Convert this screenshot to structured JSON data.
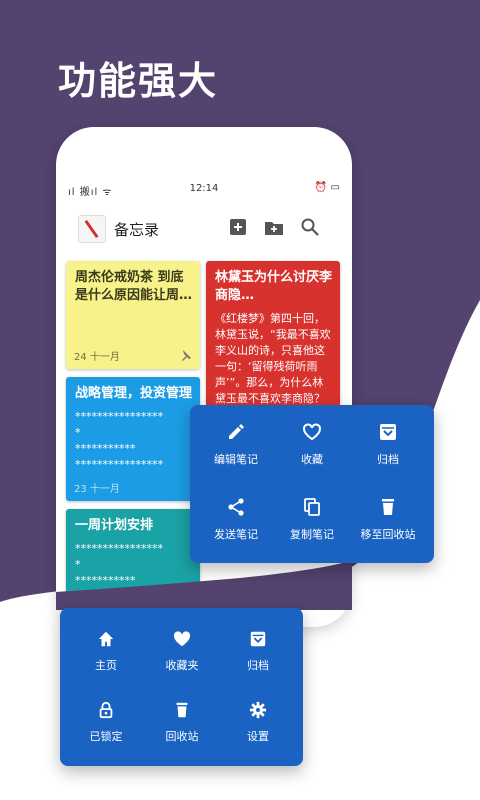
{
  "headline": "功能强大",
  "status": {
    "left": "ıl 搬ıl ᯤ",
    "time": "12:14",
    "right": "⏰ ▭"
  },
  "app": {
    "title": "备忘录"
  },
  "notes": [
    {
      "title": "周杰伦戒奶茶  到底是什么原因能让周…",
      "body": "",
      "date": "24  十一月",
      "color": "#f7f28a"
    },
    {
      "title": "林黛玉为什么讨厌李商隐…",
      "body": "《红楼梦》第四十回，林黛玉说，“我最不喜欢李义山的诗，只喜他这一句：‘留得残荷听雨声’”。那么，为什么林黛玉最不喜欢李商隐？以下是关于李商隐、关…",
      "date": "",
      "color": "#d8322f"
    },
    {
      "title": "战略管理，投资管理",
      "body": "****************\n*\n***********\n****************",
      "date": "23  十一月",
      "color": "#1d9ce6"
    },
    {
      "title": "一周计划安排",
      "body": "****************\n*\n***********",
      "date": "",
      "color": "#1aa3a6"
    }
  ],
  "note_menu": {
    "items": [
      {
        "label": "编辑笔记",
        "icon": "pencil-icon"
      },
      {
        "label": "收藏",
        "icon": "heart-outline-icon"
      },
      {
        "label": "归档",
        "icon": "archive-icon"
      },
      {
        "label": "发送笔记",
        "icon": "share-icon"
      },
      {
        "label": "复制笔记",
        "icon": "copy-icon"
      },
      {
        "label": "移至回收站",
        "icon": "trash-icon"
      }
    ]
  },
  "nav_menu": {
    "items": [
      {
        "label": "主页",
        "icon": "home-icon"
      },
      {
        "label": "收藏夹",
        "icon": "heart-icon"
      },
      {
        "label": "归档",
        "icon": "archive-icon"
      },
      {
        "label": "已锁定",
        "icon": "lock-icon"
      },
      {
        "label": "回收站",
        "icon": "trash-icon"
      },
      {
        "label": "设置",
        "icon": "gear-icon"
      }
    ]
  },
  "colors": {
    "purple": "#54426f",
    "panel": "#1a63c3"
  }
}
